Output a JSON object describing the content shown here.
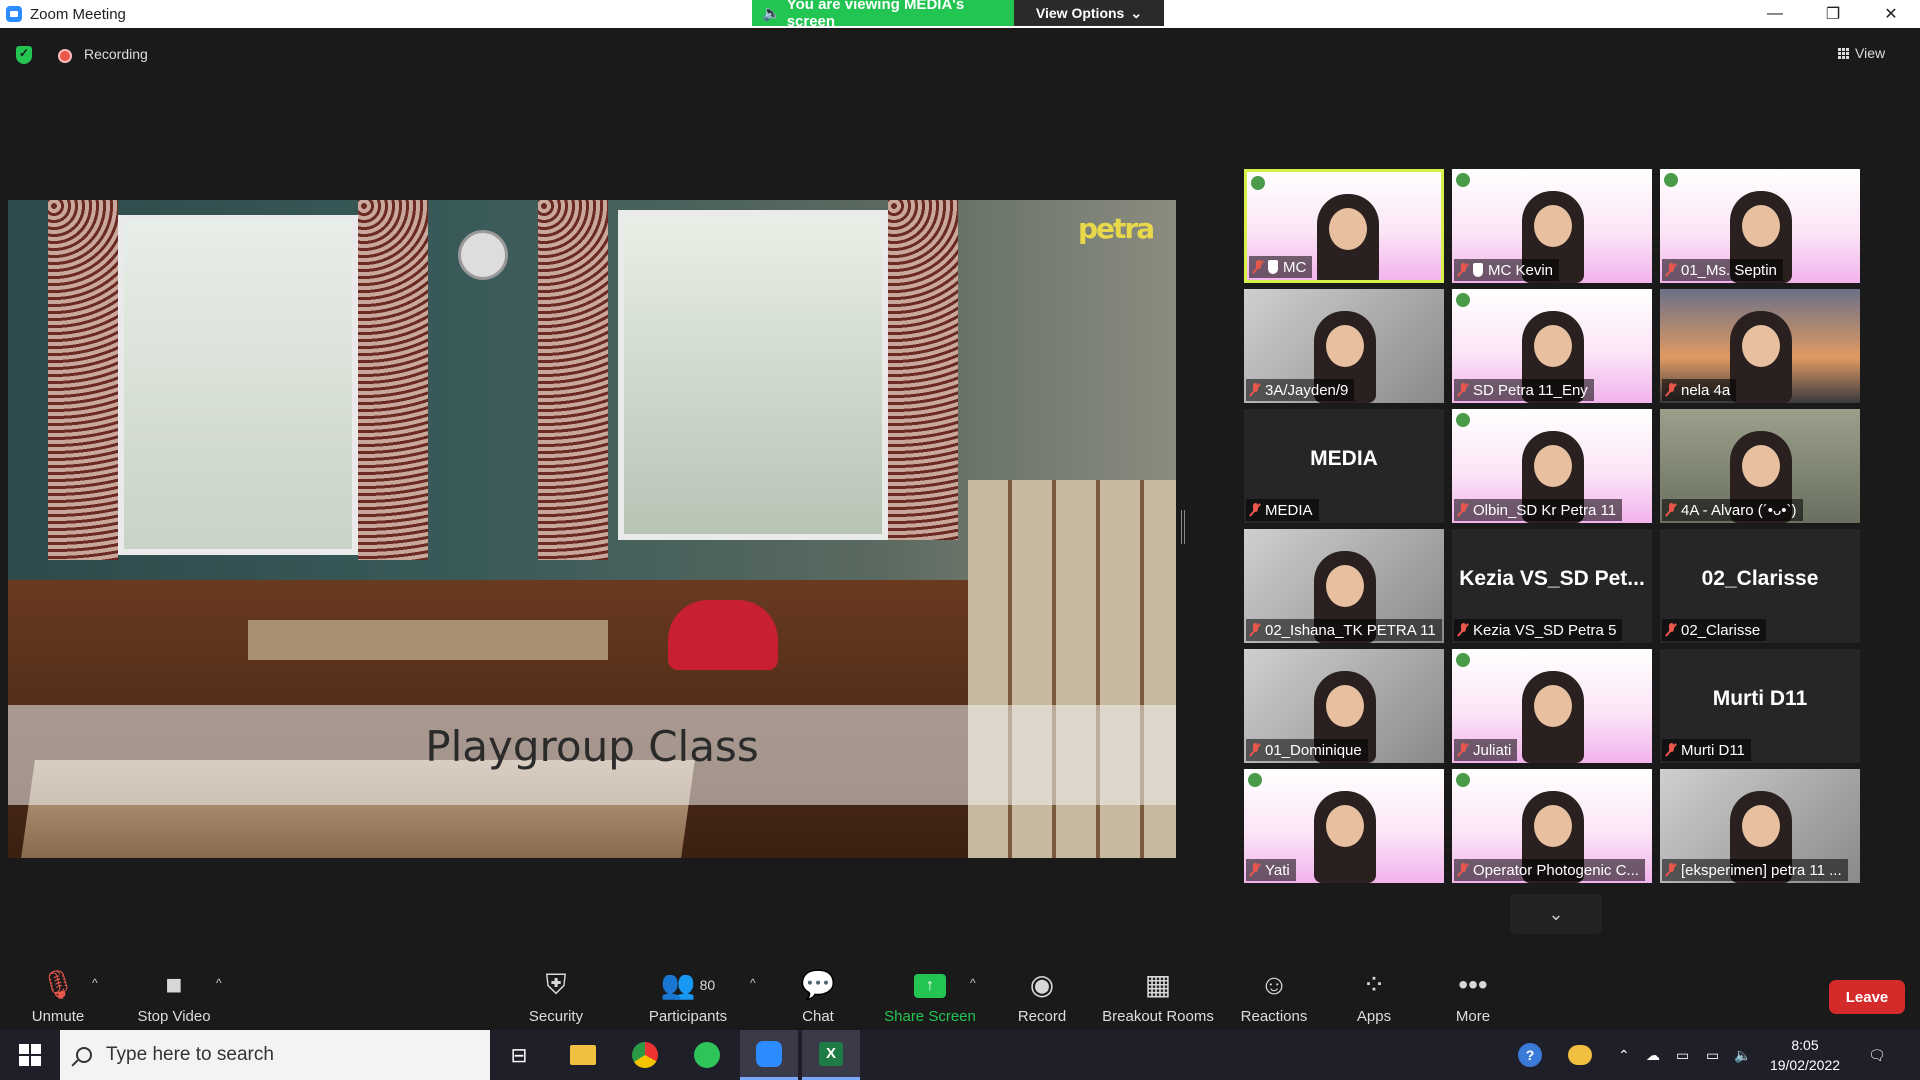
{
  "window": {
    "title": "Zoom Meeting",
    "viewing_banner": "You are viewing MEDIA's screen",
    "view_options": "View Options"
  },
  "meeting": {
    "recording_label": "Recording",
    "view_label": "View"
  },
  "shared_screen": {
    "caption": "Playgroup Class",
    "logo_text": "petra"
  },
  "gallery": [
    {
      "name": "MC",
      "kind": "video",
      "active": true,
      "spotlight": true
    },
    {
      "name": "MC Kevin",
      "kind": "video",
      "spotlight": true
    },
    {
      "name": "01_Ms. Septin",
      "kind": "video"
    },
    {
      "name": "3A/Jayden/9",
      "kind": "video"
    },
    {
      "name": "SD Petra 11_Eny",
      "kind": "video"
    },
    {
      "name": "nela 4a",
      "kind": "video"
    },
    {
      "name": "MEDIA",
      "kind": "name",
      "display": "MEDIA"
    },
    {
      "name": "Olbin_SD Kr Petra 11",
      "kind": "video"
    },
    {
      "name": "4A - Alvaro (´•ᴗ•`)",
      "kind": "video"
    },
    {
      "name": "02_Ishana_TK PETRA 11",
      "kind": "video"
    },
    {
      "name": "Kezia VS_SD Petra 5",
      "kind": "name",
      "display": "Kezia VS_SD Pet..."
    },
    {
      "name": "02_Clarisse",
      "kind": "name",
      "display": "02_Clarisse"
    },
    {
      "name": "01_Dominique",
      "kind": "video"
    },
    {
      "name": "Juliati",
      "kind": "video"
    },
    {
      "name": "Murti D11",
      "kind": "name",
      "display": "Murti D11"
    },
    {
      "name": "Yati",
      "kind": "video"
    },
    {
      "name": "Operator Photogenic C...",
      "kind": "video"
    },
    {
      "name": "[eksperimen] petra 11 ...",
      "kind": "video"
    }
  ],
  "toolbar": {
    "unmute": "Unmute",
    "stop_video": "Stop Video",
    "security": "Security",
    "participants": "Participants",
    "participants_count": "80",
    "chat": "Chat",
    "share_screen": "Share Screen",
    "record": "Record",
    "breakout_rooms": "Breakout Rooms",
    "reactions": "Reactions",
    "apps": "Apps",
    "more": "More",
    "leave": "Leave"
  },
  "taskbar": {
    "search_placeholder": "Type here to search",
    "time": "8:05",
    "date": "19/02/2022"
  },
  "colors": {
    "zoom_green": "#23c552",
    "active_speaker": "#d8f04a",
    "leave_red": "#d42a2a",
    "muted_red": "#e8574b"
  }
}
